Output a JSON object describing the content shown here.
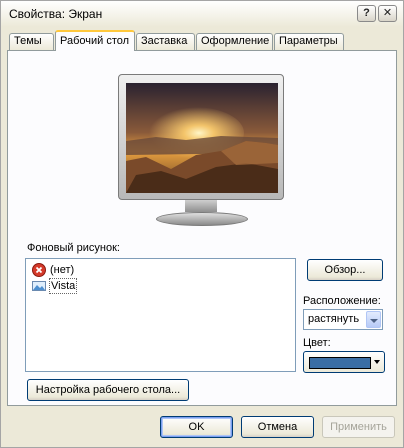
{
  "window": {
    "title": "Свойства: Экран",
    "help_glyph": "?",
    "close_glyph": "✕"
  },
  "tabs": [
    {
      "label": "Темы",
      "active": false
    },
    {
      "label": "Рабочий стол",
      "active": true
    },
    {
      "label": "Заставка",
      "active": false
    },
    {
      "label": "Оформление",
      "active": false
    },
    {
      "label": "Параметры",
      "active": false
    }
  ],
  "desktop": {
    "background_label": "Фоновый рисунок:",
    "backgrounds": [
      {
        "label": "(нет)",
        "icon": "none-red-x-icon",
        "selected": false
      },
      {
        "label": "Vista",
        "icon": "image-file-icon",
        "selected": true
      }
    ],
    "browse_label": "Обзор...",
    "position_label": "Расположение:",
    "position_value": "растянуть",
    "color_label": "Цвет:",
    "color_value": "#3a6ea5",
    "customize_label": "Настройка рабочего стола..."
  },
  "footer": {
    "ok_label": "OK",
    "cancel_label": "Отмена",
    "apply_label": "Применить"
  }
}
